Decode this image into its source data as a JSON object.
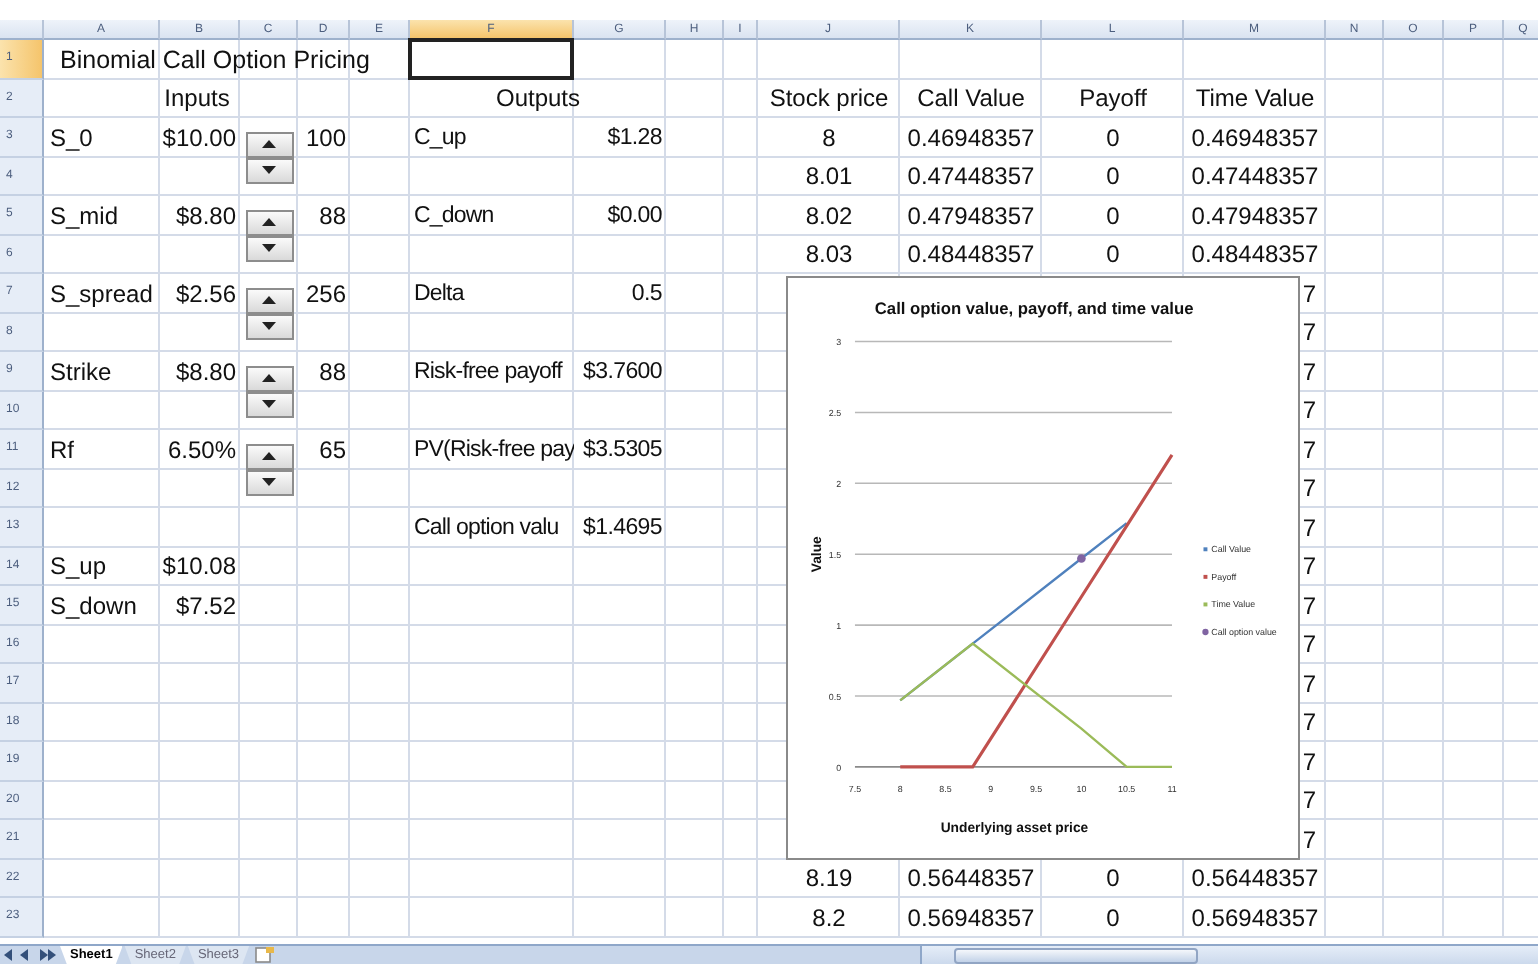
{
  "sheet": {
    "columns": [
      "A",
      "B",
      "C",
      "D",
      "E",
      "F",
      "G",
      "H",
      "I",
      "J",
      "K",
      "L",
      "M",
      "N",
      "O",
      "P",
      "Q"
    ],
    "rows": [
      "1",
      "2",
      "3",
      "4",
      "5",
      "6",
      "7",
      "8",
      "9",
      "10",
      "11",
      "12",
      "13",
      "14",
      "15",
      "16",
      "17",
      "18",
      "19",
      "20",
      "21",
      "22",
      "23"
    ],
    "tabs": [
      {
        "label": "Sheet1",
        "selected": true
      },
      {
        "label": "Sheet2",
        "selected": false
      },
      {
        "label": "Sheet3",
        "selected": false
      }
    ]
  },
  "inputs": {
    "title": "Binomial Call Option Pricing",
    "heading": "Inputs",
    "items": [
      {
        "label": "S_0",
        "value": "$10.00",
        "spinner": "100"
      },
      {
        "label": "S_mid",
        "value": "$8.80",
        "spinner": "88"
      },
      {
        "label": "S_spread",
        "value": "$2.56",
        "spinner": "256"
      },
      {
        "label": "Strike",
        "value": "$8.80",
        "spinner": "88"
      },
      {
        "label": "Rf",
        "value": "6.50%",
        "spinner": "65"
      }
    ],
    "derived": [
      {
        "label": "S_up",
        "value": "$10.08"
      },
      {
        "label": "S_down",
        "value": "$7.52"
      }
    ]
  },
  "outputs": {
    "heading": "Outputs",
    "active_cell": {
      "selected": true
    },
    "items": [
      {
        "label": "C_up",
        "value": "$1.28"
      },
      {
        "label": "C_down",
        "value": "$0.00"
      },
      {
        "label": "Delta",
        "value": "0.5"
      },
      {
        "label": "Risk-free payoff",
        "value": "$3.7600"
      },
      {
        "label": "PV(Risk-free pay",
        "value": "$3.5305"
      },
      {
        "label": "Call option valu",
        "value": "$1.4695"
      }
    ]
  },
  "table": {
    "columns": [
      "Stock price",
      "Call Value",
      "Payoff",
      "Time Value"
    ],
    "rows": [
      {
        "kind": "full",
        "cells": [
          "8",
          "0.46948357",
          "0",
          "0.46948357"
        ]
      },
      {
        "kind": "full",
        "cells": [
          "8.01",
          "0.47448357",
          "0",
          "0.47448357"
        ]
      },
      {
        "kind": "full",
        "cells": [
          "8.02",
          "0.47948357",
          "0",
          "0.47948357"
        ]
      },
      {
        "kind": "full",
        "cells": [
          "8.03",
          "0.48448357",
          "0",
          "0.48448357"
        ]
      },
      {
        "kind": "fragment",
        "cells": [
          "7"
        ]
      },
      {
        "kind": "fragment",
        "cells": [
          "7"
        ]
      },
      {
        "kind": "fragment",
        "cells": [
          "7"
        ]
      },
      {
        "kind": "fragment",
        "cells": [
          "7"
        ]
      },
      {
        "kind": "fragment",
        "cells": [
          "7"
        ]
      },
      {
        "kind": "fragment",
        "cells": [
          "7"
        ]
      },
      {
        "kind": "fragment",
        "cells": [
          "7"
        ]
      },
      {
        "kind": "fragment",
        "cells": [
          "7"
        ]
      },
      {
        "kind": "fragment",
        "cells": [
          "7"
        ]
      },
      {
        "kind": "fragment",
        "cells": [
          "7"
        ]
      },
      {
        "kind": "fragment",
        "cells": [
          "7"
        ]
      },
      {
        "kind": "fragment",
        "cells": [
          "7"
        ]
      },
      {
        "kind": "fragment",
        "cells": [
          "7"
        ]
      },
      {
        "kind": "fragment",
        "cells": [
          "7"
        ]
      },
      {
        "kind": "fragment",
        "cells": [
          "7"
        ]
      },
      {
        "kind": "full",
        "cells": [
          "8.19",
          "0.56448357",
          "0",
          "0.56448357"
        ]
      },
      {
        "kind": "full",
        "cells": [
          "8.2",
          "0.56948357",
          "0",
          "0.56948357"
        ]
      }
    ]
  },
  "chart": {
    "chart_data": {
      "type": "line",
      "title": "Call option value, payoff, and time value",
      "xlabel": "Underlying asset price",
      "ylabel": "Value",
      "x": [
        8,
        8.8,
        10,
        10.5,
        11
      ],
      "series": [
        {
          "name": "Call Value",
          "color": "#4f81bd",
          "values": [
            0.47,
            0.87,
            1.47,
            1.72,
            null
          ]
        },
        {
          "name": "Payoff",
          "color": "#c0504d",
          "values": [
            0,
            0,
            1.2,
            1.7,
            2.2
          ]
        },
        {
          "name": "Time Value",
          "color": "#9bbb59",
          "values": [
            0.47,
            0.87,
            0.27,
            0,
            0
          ]
        },
        {
          "name": "Call option value",
          "color": "#8064a2",
          "marker": "circle",
          "values": [
            null,
            null,
            1.47,
            null,
            null
          ]
        }
      ],
      "grid": true,
      "legend": "right",
      "xlim": [
        7.5,
        11
      ],
      "ylim": [
        0,
        3
      ],
      "xticks": [
        7.5,
        8,
        8.5,
        9,
        9.5,
        10,
        10.5,
        11
      ],
      "yticks": [
        0,
        0.5,
        1,
        1.5,
        2,
        2.5,
        3
      ]
    }
  }
}
